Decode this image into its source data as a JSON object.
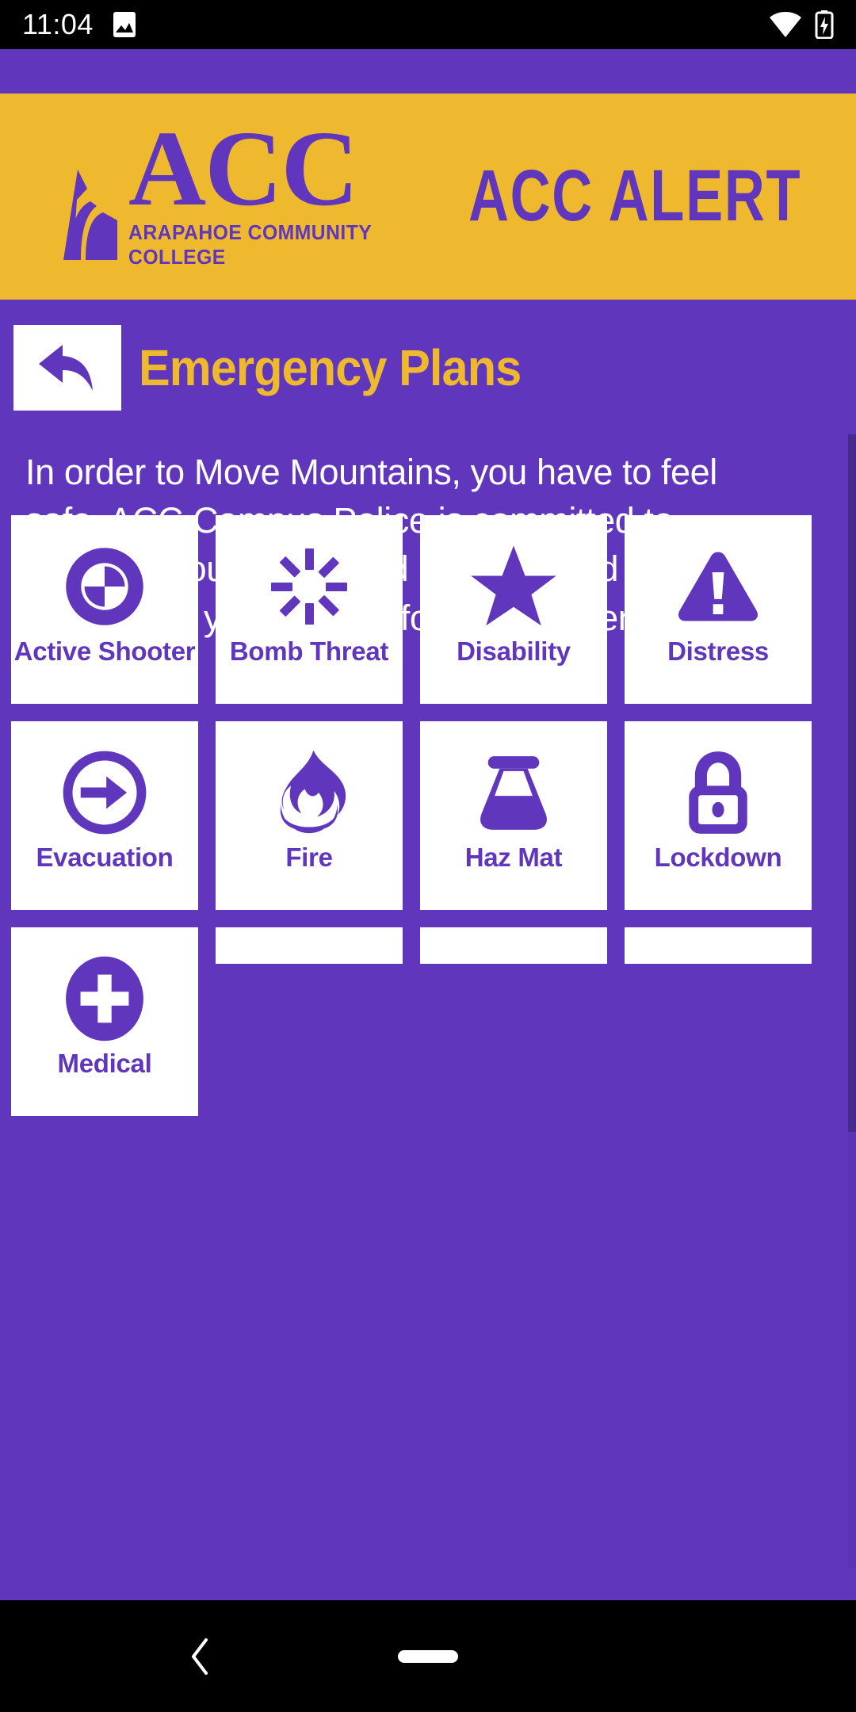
{
  "status_bar": {
    "time": "11:04",
    "left_icons": [
      "image-icon"
    ],
    "right_icons": [
      "wifi-icon",
      "battery-charging-icon"
    ]
  },
  "banner": {
    "logo_mark": "acc-mountain-logo-icon",
    "logo_text": "ACC",
    "tagline": "ARAPAHOE COMMUNITY COLLEGE",
    "app_name": "ACC ALERT"
  },
  "header": {
    "back_icon": "back-arrow-icon",
    "title": "Emergency Plans"
  },
  "description": "In order to Move Mountains, you have to feel safe. ACC Campus Police is committed to ensuring your safety and has provided the below tips to help you prepare for an emergency.",
  "tiles": [
    {
      "label": "Active Shooter",
      "icon": "crosshair-target-icon"
    },
    {
      "label": "Bomb Threat",
      "icon": "explosion-burst-icon"
    },
    {
      "label": "Disability",
      "icon": "star-icon"
    },
    {
      "label": "Distress",
      "icon": "warning-triangle-icon"
    },
    {
      "label": "Evacuation",
      "icon": "arrow-right-circle-icon"
    },
    {
      "label": "Fire",
      "icon": "flame-icon"
    },
    {
      "label": "Haz Mat",
      "icon": "flask-beaker-icon"
    },
    {
      "label": "Lockdown",
      "icon": "padlock-icon"
    },
    {
      "label": "Medical",
      "icon": "medical-plus-circle-icon"
    }
  ],
  "nav_bar": {
    "back_icon": "chevron-left-icon",
    "home_icon": "home-pill-icon"
  },
  "colors": {
    "purple": "#6036bd",
    "gold": "#eeb92e",
    "white": "#ffffff",
    "black": "#000000",
    "scrollbar": "#472a8e"
  }
}
